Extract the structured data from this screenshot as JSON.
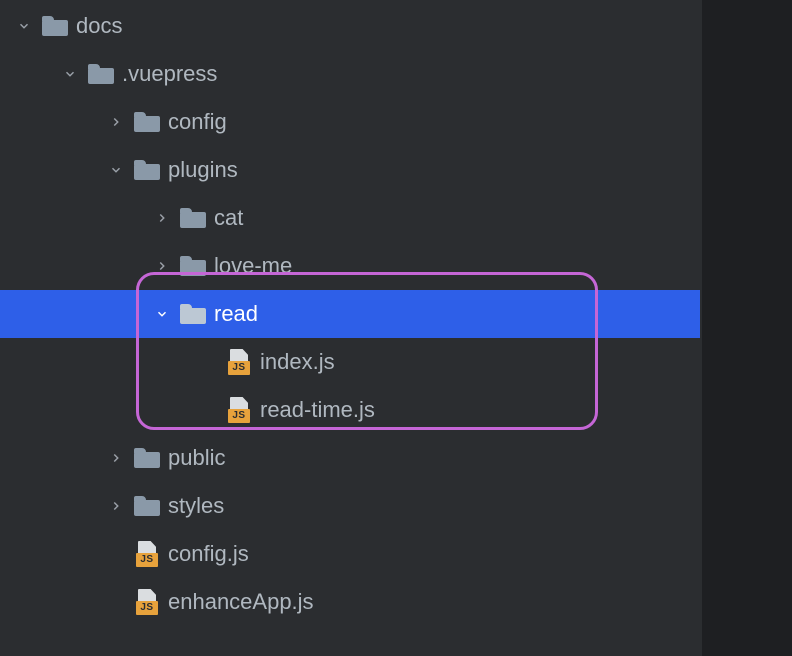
{
  "tree": {
    "docs": "docs",
    "vuepress": ".vuepress",
    "config": "config",
    "plugins": "plugins",
    "cat": "cat",
    "loveme": "love-me",
    "read": "read",
    "index_js": "index.js",
    "readtime_js": "read-time.js",
    "public": "public",
    "styles": "styles",
    "config_js": "config.js",
    "enhanceapp_js": "enhanceApp.js"
  },
  "icons": {
    "js_badge": "JS"
  },
  "colors": {
    "selection": "#2e5fe8",
    "highlight_border": "#c566d6",
    "background": "#2b2d30",
    "folder_fill": "#8a99a8",
    "js_badge": "#e7a23c"
  }
}
